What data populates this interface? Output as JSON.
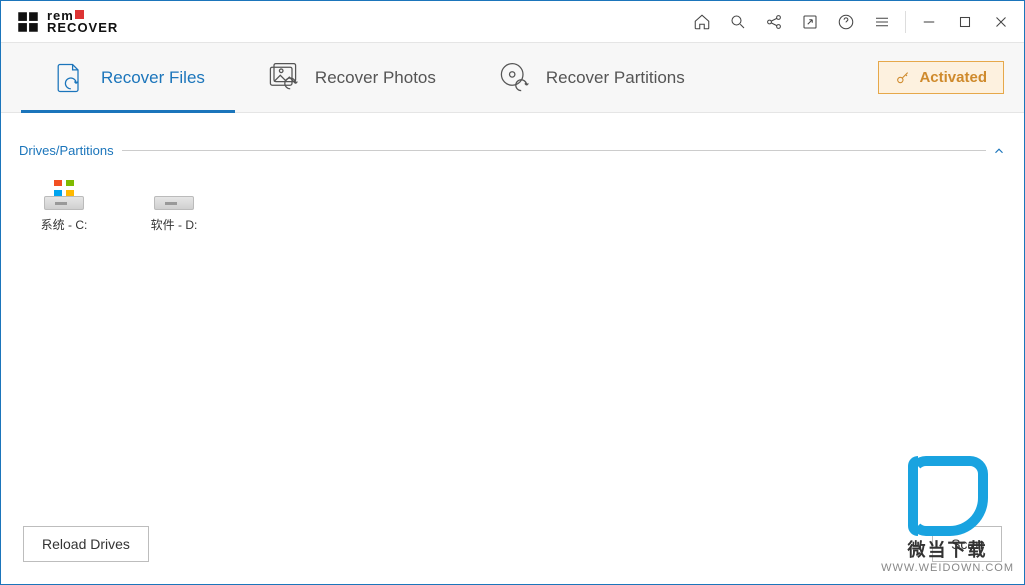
{
  "app": {
    "logo_line1": "rem",
    "logo_line2": "RECOVER"
  },
  "titlebar_icons": [
    {
      "name": "home-icon"
    },
    {
      "name": "search-icon"
    },
    {
      "name": "share-icon"
    },
    {
      "name": "export-icon"
    },
    {
      "name": "help-icon"
    },
    {
      "name": "menu-icon"
    }
  ],
  "window_icons": [
    {
      "name": "minimize-icon"
    },
    {
      "name": "maximize-icon"
    },
    {
      "name": "close-icon"
    }
  ],
  "tabs": [
    {
      "label": "Recover Files",
      "active": true
    },
    {
      "label": "Recover Photos",
      "active": false
    },
    {
      "label": "Recover Partitions",
      "active": false
    }
  ],
  "activation": {
    "label": "Activated"
  },
  "section": {
    "title": "Drives/Partitions"
  },
  "drives": [
    {
      "label": "系统 - C:",
      "has_os": true
    },
    {
      "label": "软件 - D:",
      "has_os": false
    }
  ],
  "footer": {
    "reload_label": "Reload Drives",
    "scan_label": "Scan"
  },
  "watermark": {
    "line1": "微当下载",
    "line2": "WWW.WEIDOWN.COM"
  }
}
